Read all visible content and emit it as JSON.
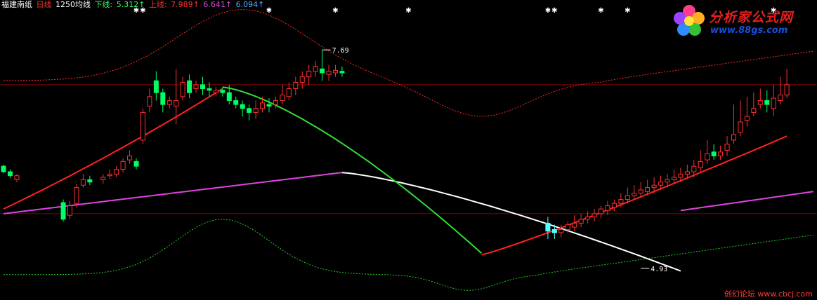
{
  "legend": {
    "stock_name": "福建南纸",
    "period": "日线",
    "indicator": "1250均线",
    "lower_label": "下线:",
    "lower_value": "5.312↑",
    "upper_label": "上线:",
    "upper_value": "7.989↑",
    "mid_value": "6.641↑",
    "ma_value": "6.094↑"
  },
  "watermark": {
    "title": "分析家公式网",
    "url": "www.88gs.com"
  },
  "footer_text": "创幻论坛 www.cbcj.com",
  "colors": {
    "up": "#ff3030",
    "down": "#00ff66",
    "down_alt": "#55ffff",
    "upper_band": "#ff2a2a",
    "lower_band": "#22cc22",
    "slow_ma": "#dd44dd",
    "white": "#ffffff",
    "green_line": "#33dd33",
    "red_line": "#ff2222",
    "ref_line": "#8a0000"
  },
  "chart_data": {
    "type": "candlestick",
    "price_range": [
      4.6,
      8.25
    ],
    "reference_prices": [
      7.25,
      5.62
    ],
    "annotations": [
      {
        "label": "7.69",
        "index": 48,
        "price": 7.69
      },
      {
        "label": "4.93",
        "index": 96,
        "price": 4.93
      }
    ],
    "signal_indices": [
      20,
      21,
      40,
      50,
      61,
      82,
      83,
      90,
      94,
      116
    ],
    "candles": [
      [
        0,
        6.22,
        6.15,
        6.24,
        6.13
      ],
      [
        1,
        6.15,
        6.1,
        6.18,
        6.07
      ],
      [
        2,
        6.05,
        6.1,
        6.12,
        6.02
      ],
      [
        9,
        5.76,
        5.55,
        5.8,
        5.52
      ],
      [
        10,
        5.6,
        5.72,
        5.78,
        5.55
      ],
      [
        11,
        5.75,
        5.95,
        6.0,
        5.7
      ],
      [
        12,
        5.98,
        6.05,
        6.12,
        5.95
      ],
      [
        13,
        6.05,
        6.02,
        6.1,
        5.98
      ],
      [
        15,
        6.05,
        6.08,
        6.12,
        6.0
      ],
      [
        16,
        6.1,
        6.12,
        6.18,
        6.06
      ],
      [
        17,
        6.12,
        6.18,
        6.22,
        6.08
      ],
      [
        18,
        6.18,
        6.28,
        6.32,
        6.14
      ],
      [
        19,
        6.3,
        6.35,
        6.42,
        6.25
      ],
      [
        20,
        6.28,
        6.22,
        6.32,
        6.18
      ],
      [
        21,
        6.55,
        6.9,
        6.95,
        6.5
      ],
      [
        22,
        6.98,
        7.1,
        7.2,
        6.9
      ],
      [
        23,
        7.3,
        7.15,
        7.42,
        7.05
      ],
      [
        24,
        7.15,
        7.0,
        7.2,
        6.9
      ],
      [
        25,
        7.0,
        7.05,
        7.1,
        6.95
      ],
      [
        26,
        6.98,
        7.05,
        7.45,
        6.75
      ],
      [
        27,
        7.1,
        7.28,
        7.35,
        7.05
      ],
      [
        28,
        7.3,
        7.15,
        7.38,
        7.08
      ],
      [
        29,
        7.2,
        7.25,
        7.3,
        7.15
      ],
      [
        30,
        7.25,
        7.2,
        7.35,
        7.12
      ],
      [
        31,
        7.2,
        7.18,
        7.28,
        7.1
      ],
      [
        32,
        7.15,
        7.18,
        7.22,
        7.1
      ],
      [
        33,
        7.18,
        7.15,
        7.22,
        7.1
      ],
      [
        34,
        7.15,
        7.05,
        7.25,
        7.0
      ],
      [
        35,
        7.05,
        7.0,
        7.1,
        6.95
      ],
      [
        36,
        7.0,
        6.95,
        7.05,
        6.85
      ],
      [
        37,
        6.95,
        6.9,
        7.0,
        6.8
      ],
      [
        38,
        6.9,
        6.95,
        7.05,
        6.82
      ],
      [
        39,
        6.95,
        7.02,
        7.1,
        6.9
      ],
      [
        40,
        7.0,
        6.98,
        7.08,
        6.9
      ],
      [
        41,
        7.0,
        7.05,
        7.1,
        6.95
      ],
      [
        42,
        7.05,
        7.12,
        7.25,
        7.0
      ],
      [
        43,
        7.1,
        7.2,
        7.28,
        7.05
      ],
      [
        44,
        7.2,
        7.28,
        7.35,
        7.12
      ],
      [
        45,
        7.28,
        7.35,
        7.42,
        7.2
      ],
      [
        46,
        7.35,
        7.42,
        7.5,
        7.25
      ],
      [
        47,
        7.42,
        7.48,
        7.55,
        7.35
      ],
      [
        48,
        7.45,
        7.4,
        7.69,
        7.3
      ],
      [
        49,
        7.38,
        7.42,
        7.5,
        7.3
      ],
      [
        50,
        7.4,
        7.43,
        7.5,
        7.35
      ],
      [
        51,
        7.42,
        7.4,
        7.48,
        7.35
      ],
      [
        82,
        5.5,
        5.4,
        5.58,
        5.3
      ],
      [
        83,
        5.42,
        5.38,
        5.48,
        5.3
      ],
      [
        84,
        5.38,
        5.42,
        5.48,
        5.32
      ],
      [
        85,
        5.42,
        5.48,
        5.52,
        5.38
      ],
      [
        86,
        5.45,
        5.5,
        5.6,
        5.4
      ],
      [
        87,
        5.5,
        5.55,
        5.62,
        5.45
      ],
      [
        88,
        5.55,
        5.58,
        5.65,
        5.5
      ],
      [
        89,
        5.58,
        5.62,
        5.68,
        5.52
      ],
      [
        90,
        5.62,
        5.68,
        5.72,
        5.56
      ],
      [
        91,
        5.66,
        5.72,
        5.78,
        5.6
      ],
      [
        92,
        5.7,
        5.75,
        5.8,
        5.65
      ],
      [
        93,
        5.75,
        5.8,
        5.88,
        5.7
      ],
      [
        94,
        5.8,
        5.85,
        5.95,
        5.75
      ],
      [
        95,
        5.85,
        5.88,
        5.98,
        5.8
      ],
      [
        96,
        5.88,
        5.92,
        6.02,
        5.82
      ],
      [
        97,
        5.9,
        5.95,
        6.05,
        5.85
      ],
      [
        98,
        5.95,
        5.98,
        6.08,
        5.88
      ],
      [
        99,
        5.98,
        6.02,
        6.1,
        5.92
      ],
      [
        100,
        6.02,
        6.05,
        6.12,
        5.95
      ],
      [
        101,
        6.05,
        6.08,
        6.18,
        6.0
      ],
      [
        102,
        6.08,
        6.12,
        6.2,
        6.02
      ],
      [
        103,
        6.12,
        6.15,
        6.24,
        6.06
      ],
      [
        104,
        6.15,
        6.22,
        6.3,
        6.08
      ],
      [
        105,
        6.2,
        6.28,
        6.42,
        6.15
      ],
      [
        106,
        6.3,
        6.38,
        6.55,
        6.25
      ],
      [
        107,
        6.4,
        6.35,
        6.5,
        6.3
      ],
      [
        108,
        6.35,
        6.4,
        6.48,
        6.3
      ],
      [
        109,
        6.42,
        6.5,
        6.6,
        6.35
      ],
      [
        110,
        6.55,
        6.62,
        7.0,
        6.5
      ],
      [
        111,
        6.65,
        6.78,
        7.05,
        6.6
      ],
      [
        112,
        6.8,
        6.85,
        7.1,
        6.72
      ],
      [
        113,
        6.9,
        6.95,
        7.15,
        6.85
      ],
      [
        114,
        7.0,
        7.05,
        7.2,
        6.95
      ],
      [
        115,
        7.05,
        7.0,
        7.18,
        6.9
      ],
      [
        116,
        6.95,
        7.08,
        7.25,
        6.85
      ],
      [
        117,
        7.05,
        7.12,
        7.35,
        7.0
      ],
      [
        118,
        7.12,
        7.25,
        7.45,
        7.08
      ]
    ]
  }
}
